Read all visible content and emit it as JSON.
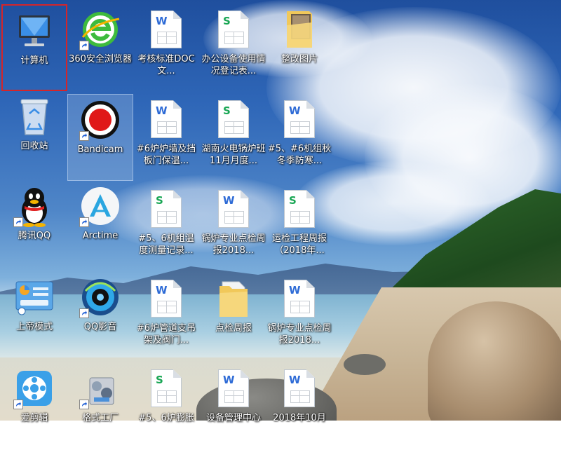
{
  "desktop": {
    "icons": [
      {
        "label": "计算机",
        "icon": "computer-icon",
        "shortcut": false
      },
      {
        "label": "360安全浏览器",
        "icon": "browser-360-icon",
        "shortcut": true
      },
      {
        "label": "考核标准DOC 文...",
        "icon": "word-doc-icon",
        "shortcut": false
      },
      {
        "label": "办公设备使用情况登记表...",
        "icon": "spreadsheet-icon",
        "shortcut": false
      },
      {
        "label": "整改图片",
        "icon": "folder-icon",
        "shortcut": false
      },
      {
        "label": "回收站",
        "icon": "recycle-bin-icon",
        "shortcut": false
      },
      {
        "label": "Bandicam",
        "icon": "bandicam-icon",
        "shortcut": true
      },
      {
        "label": "#6炉炉墙及挡板门保温...",
        "icon": "word-doc-icon",
        "shortcut": false
      },
      {
        "label": "湖南火电锅炉班11月月度...",
        "icon": "spreadsheet-icon",
        "shortcut": false
      },
      {
        "label": "#5、#6机组秋冬季防寒...",
        "icon": "word-doc-icon",
        "shortcut": false
      },
      {
        "label": "腾讯QQ",
        "icon": "qq-penguin-icon",
        "shortcut": true
      },
      {
        "label": "Arctime",
        "icon": "arctime-icon",
        "shortcut": true
      },
      {
        "label": "#5、6机组温度测量记录...",
        "icon": "spreadsheet-icon",
        "shortcut": false
      },
      {
        "label": "锅炉专业点检周报2018...",
        "icon": "word-doc-icon",
        "shortcut": false
      },
      {
        "label": "运检工程周报（2018年...",
        "icon": "spreadsheet-icon",
        "shortcut": false
      },
      {
        "label": "上帝模式",
        "icon": "control-panel-icon",
        "shortcut": false
      },
      {
        "label": "QQ影音",
        "icon": "qq-player-icon",
        "shortcut": true
      },
      {
        "label": "#6炉管道支吊架及阀门...",
        "icon": "word-doc-icon",
        "shortcut": false
      },
      {
        "label": "点检周报",
        "icon": "folder-icon",
        "shortcut": false
      },
      {
        "label": "锅炉专业点检周报2018...",
        "icon": "word-doc-icon",
        "shortcut": false
      },
      {
        "label": "爱剪辑",
        "icon": "video-editor-icon",
        "shortcut": true
      },
      {
        "label": "格式工厂",
        "icon": "format-factory-icon",
        "shortcut": true
      },
      {
        "label": "#5、6炉膨胀",
        "icon": "spreadsheet-icon",
        "shortcut": false
      },
      {
        "label": "设备管理中心",
        "icon": "word-doc-icon",
        "shortcut": false
      },
      {
        "label": "2018年10月",
        "icon": "word-doc-icon",
        "shortcut": false
      }
    ],
    "selected_index": 0,
    "hover_index": 6,
    "colors": {
      "selection_border": "#d4252a",
      "word_blue": "#2e6bd6",
      "sheet_green": "#19a654"
    }
  }
}
